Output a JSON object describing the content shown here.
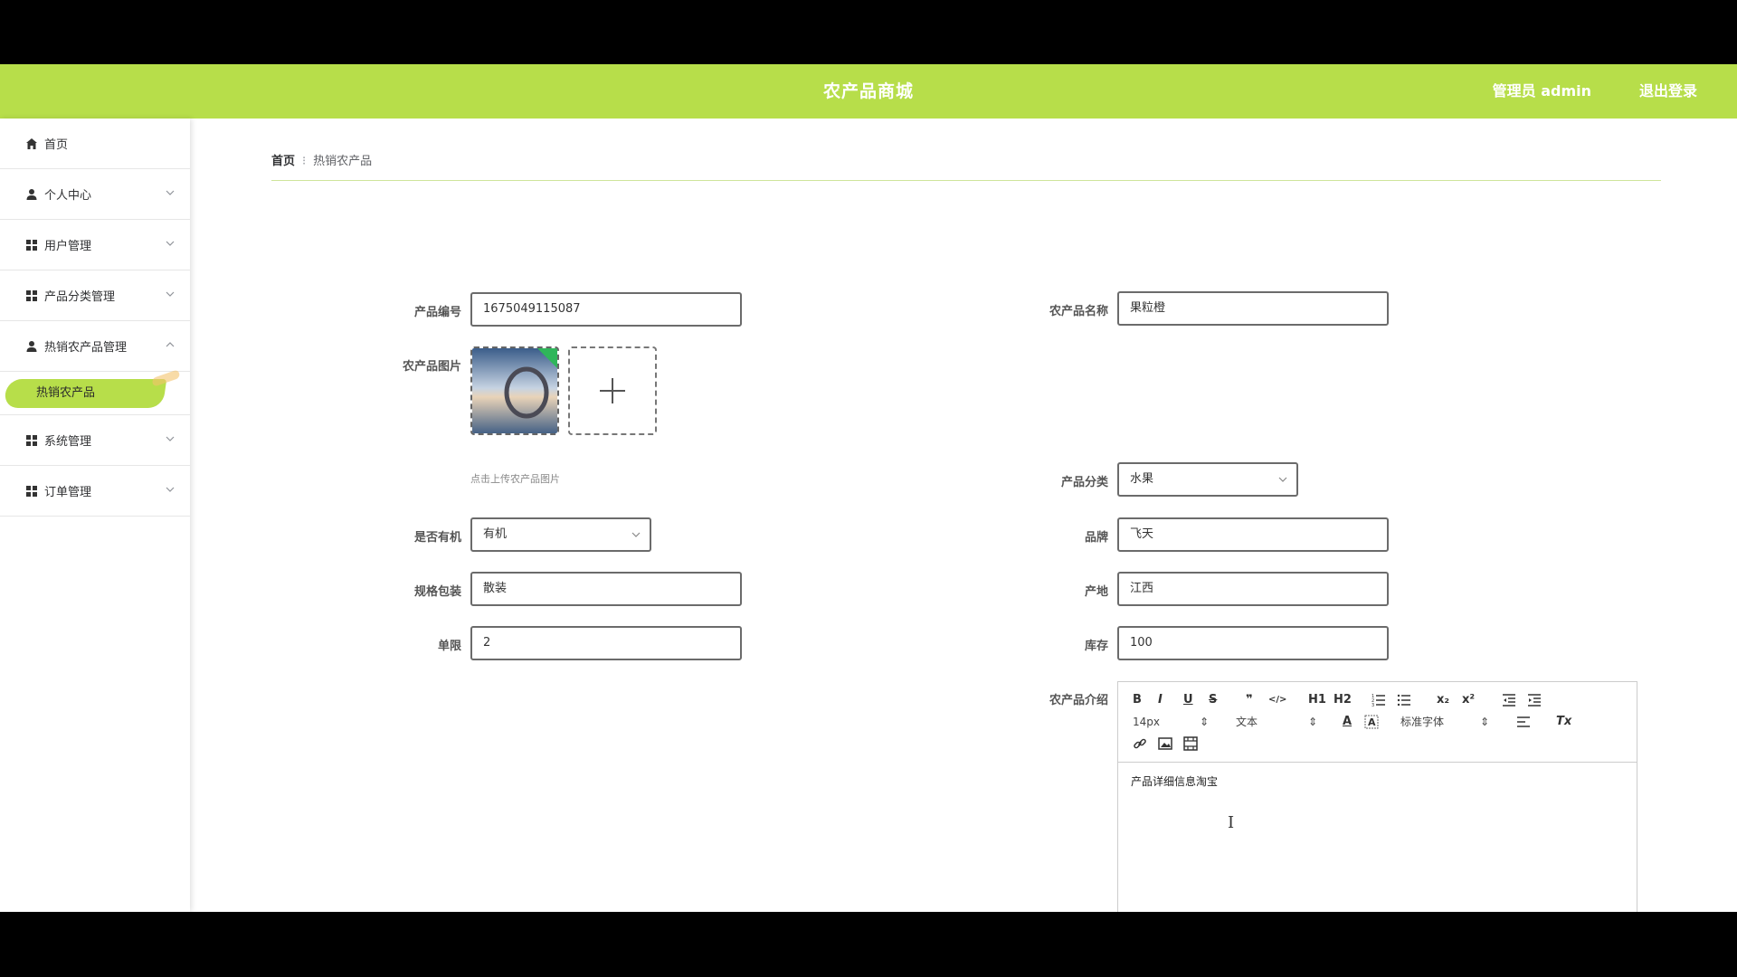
{
  "header": {
    "title": "农产品商城",
    "admin": "管理员 admin",
    "logout": "退出登录"
  },
  "sidebar": {
    "items": [
      {
        "label": "首页"
      },
      {
        "label": "个人中心"
      },
      {
        "label": "用户管理"
      },
      {
        "label": "产品分类管理"
      },
      {
        "label": "热销农产品管理"
      },
      {
        "label": "系统管理"
      },
      {
        "label": "订单管理"
      }
    ],
    "active_sub": "热销农产品"
  },
  "breadcrumb": {
    "home": "首页",
    "sep": "⁝",
    "current": "热销农产品"
  },
  "form": {
    "product_no": {
      "label": "产品编号",
      "value": "1675049115087"
    },
    "product_name": {
      "label": "农产品名称",
      "value": "果粒橙"
    },
    "image": {
      "label": "农产品图片",
      "hint": "点击上传农产品图片"
    },
    "category": {
      "label": "产品分类",
      "value": "水果"
    },
    "organic": {
      "label": "是否有机",
      "value": "有机"
    },
    "brand": {
      "label": "品牌",
      "value": "飞天"
    },
    "package": {
      "label": "规格包装",
      "value": "散装"
    },
    "origin": {
      "label": "产地",
      "value": "江西"
    },
    "limit": {
      "label": "单限",
      "value": "2"
    },
    "stock": {
      "label": "库存",
      "value": "100"
    },
    "intro": {
      "label": "农产品介绍",
      "content": "产品详细信息淘宝"
    }
  },
  "editor": {
    "font_size": "14px",
    "format": "文本",
    "font_family": "标准字体",
    "buttons": [
      "B",
      "I",
      "U",
      "S",
      "❞",
      "</>",
      "H1",
      "H2",
      "ol",
      "ul",
      "x₂",
      "x²",
      "outdent",
      "indent",
      "A",
      "bg",
      "align",
      "Tx",
      "link",
      "image",
      "video"
    ]
  }
}
